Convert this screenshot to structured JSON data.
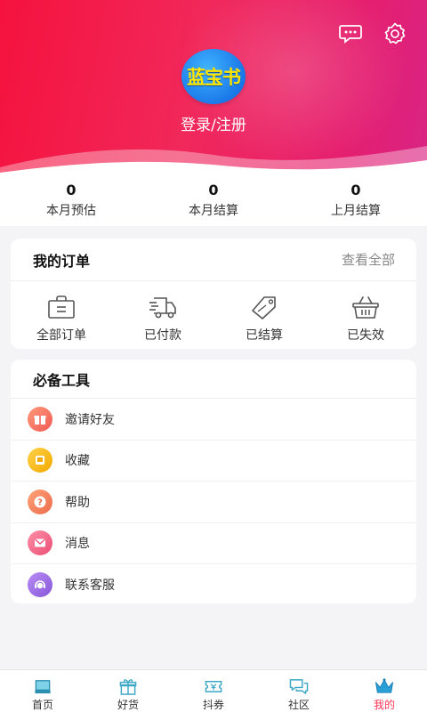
{
  "header": {
    "logo_text": "蓝宝书",
    "login_label": "登录/注册",
    "icons": [
      "message-icon",
      "settings-icon"
    ]
  },
  "stats": [
    {
      "value": "0",
      "label": "本月预估"
    },
    {
      "value": "0",
      "label": "本月结算"
    },
    {
      "value": "0",
      "label": "上月结算"
    }
  ],
  "orders": {
    "title": "我的订单",
    "view_all": "查看全部",
    "items": [
      {
        "label": "全部订单",
        "icon": "shopping-bag-icon"
      },
      {
        "label": "已付款",
        "icon": "delivery-truck-icon"
      },
      {
        "label": "已结算",
        "icon": "price-tag-icon"
      },
      {
        "label": "已失效",
        "icon": "basket-icon"
      }
    ]
  },
  "tools": {
    "title": "必备工具",
    "items": [
      {
        "label": "邀请好友",
        "icon": "gift-icon",
        "color": "#f26a5e"
      },
      {
        "label": "收藏",
        "icon": "favorites-icon",
        "color": "#f5b400"
      },
      {
        "label": "帮助",
        "icon": "help-icon",
        "color": "#f0805c"
      },
      {
        "label": "消息",
        "icon": "mail-icon",
        "color": "#f26a86"
      },
      {
        "label": "联系客服",
        "icon": "customer-service-icon",
        "color": "#9a6de0"
      }
    ]
  },
  "tabbar": {
    "active": "我的",
    "accent": "#ff3355",
    "items": [
      {
        "label": "首页",
        "icon": "home-icon"
      },
      {
        "label": "好货",
        "icon": "gift-box-icon"
      },
      {
        "label": "抖券",
        "icon": "coupon-icon"
      },
      {
        "label": "社区",
        "icon": "chat-bubbles-icon"
      },
      {
        "label": "我的",
        "icon": "crown-icon"
      }
    ]
  }
}
